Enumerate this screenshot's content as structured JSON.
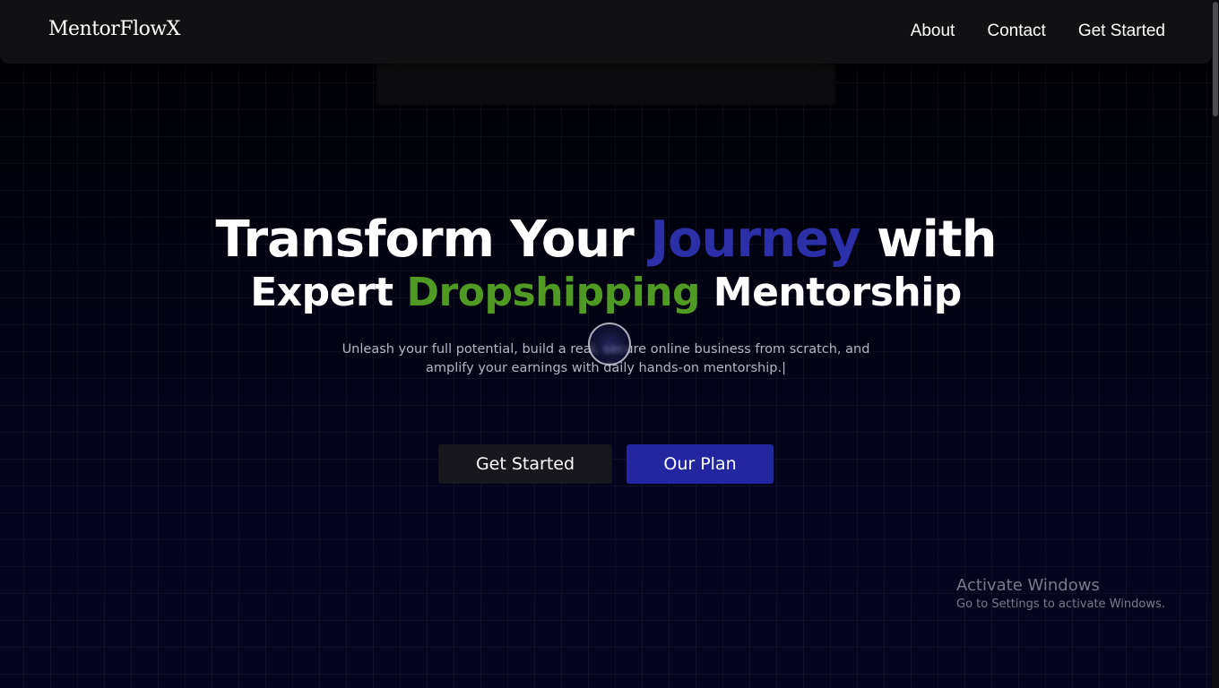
{
  "nav": {
    "brand": "MentorFlowX",
    "links": [
      "About",
      "Contact",
      "Get Started"
    ]
  },
  "hero": {
    "line1": {
      "before": "Transform Your ",
      "highlight": "Journey",
      "after": " with"
    },
    "line2": {
      "before": "Expert ",
      "highlight": "Dropshipping",
      "after": " Mentorship"
    },
    "subtitle_line1": "Unleash your full potential, build a real, secure online business from scratch, and",
    "subtitle_line2": "amplify your earnings with daily hands-on mentorship.|"
  },
  "buttons": {
    "primary": "Get Started",
    "secondary": "Our Plan"
  },
  "watermark": {
    "title": "Activate Windows",
    "subtitle": "Go to Settings to activate Windows."
  },
  "colors": {
    "accent_blue": "#2b2fa8",
    "accent_green": "#4e9a22",
    "button_blue": "#2227a0"
  }
}
